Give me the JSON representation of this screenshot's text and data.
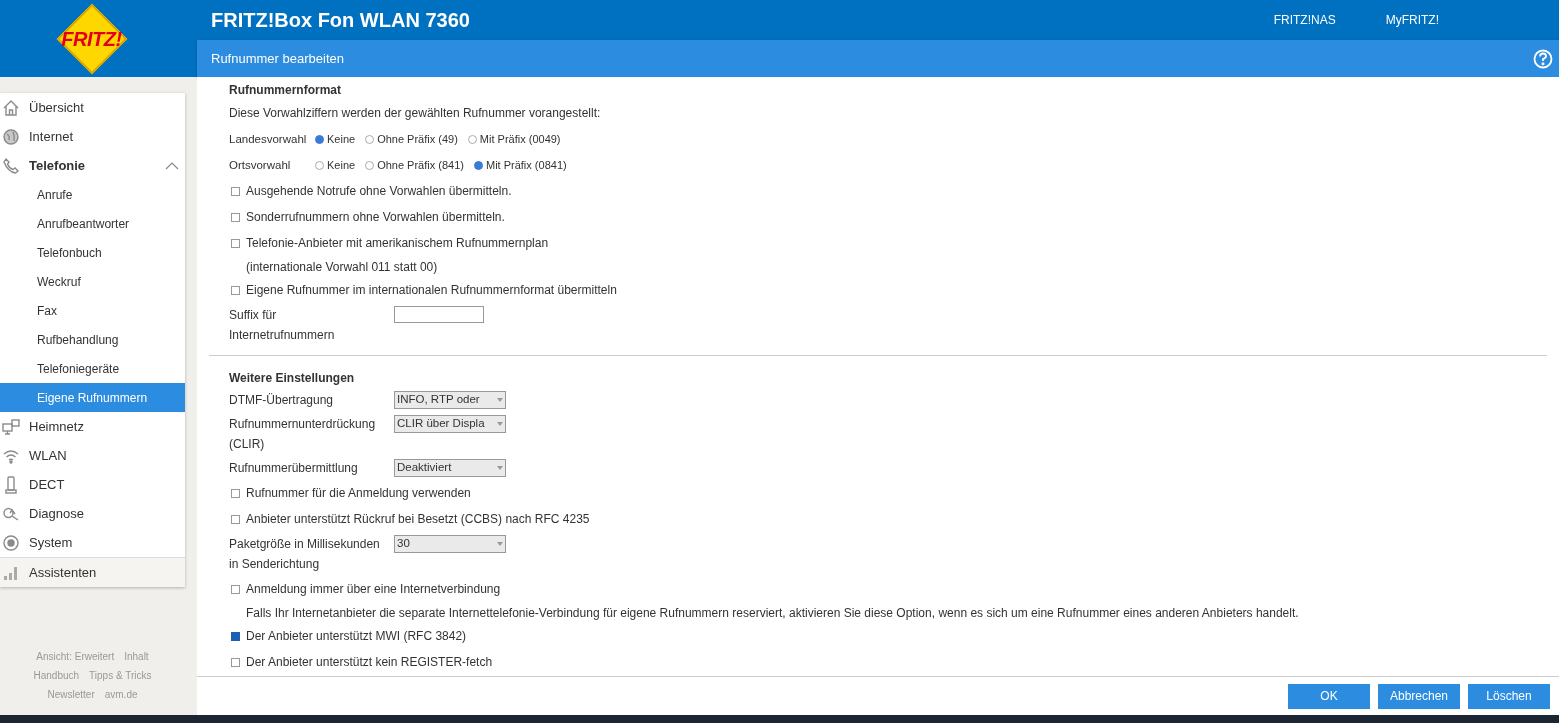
{
  "header": {
    "product_title": "FRITZ!Box Fon WLAN 7360",
    "links": [
      "FRITZ!NAS",
      "MyFRITZ!"
    ],
    "logo": "FRITZ!"
  },
  "page_title": "Rufnummer bearbeiten",
  "sidebar": {
    "items": [
      {
        "label": "Übersicht",
        "expanded": false,
        "selected": false
      },
      {
        "label": "Internet",
        "expanded": false,
        "selected": false
      },
      {
        "label": "Telefonie",
        "expanded": true,
        "selected": false,
        "children": [
          {
            "label": "Anrufe",
            "selected": false
          },
          {
            "label": "Anrufbeantworter",
            "selected": false
          },
          {
            "label": "Telefonbuch",
            "selected": false
          },
          {
            "label": "Weckruf",
            "selected": false
          },
          {
            "label": "Fax",
            "selected": false
          },
          {
            "label": "Rufbehandlung",
            "selected": false
          },
          {
            "label": "Telefoniegeräte",
            "selected": false
          },
          {
            "label": "Eigene Rufnummern",
            "selected": true
          }
        ]
      },
      {
        "label": "Heimnetz",
        "expanded": false,
        "selected": false
      },
      {
        "label": "WLAN",
        "expanded": false,
        "selected": false
      },
      {
        "label": "DECT",
        "expanded": false,
        "selected": false
      },
      {
        "label": "Diagnose",
        "expanded": false,
        "selected": false
      },
      {
        "label": "System",
        "expanded": false,
        "selected": false
      }
    ],
    "assistant": {
      "label": "Assistenten"
    },
    "footer_links": [
      [
        "Ansicht: Erweitert",
        "Inhalt"
      ],
      [
        "Handbuch",
        "Tipps & Tricks"
      ],
      [
        "Newsletter",
        "avm.de"
      ]
    ]
  },
  "sections": [
    {
      "title": "Rufnummernformat",
      "items": [
        {
          "kind": "text",
          "text": "Diese Vorwahlziffern werden der gewählten Rufnummer vorangestellt:"
        },
        {
          "kind": "radio",
          "label": "Landesvorwahl",
          "options": [
            {
              "label": "Keine",
              "selected": true
            },
            {
              "label": "Ohne Präfix (49)",
              "selected": false
            },
            {
              "label": "Mit Präfix (0049)",
              "selected": false
            }
          ]
        },
        {
          "kind": "radio",
          "label": "Ortsvorwahl",
          "options": [
            {
              "label": "Keine",
              "selected": false
            },
            {
              "label": "Ohne Präfix (841)",
              "selected": false
            },
            {
              "label": "Mit Präfix (0841)",
              "selected": true
            }
          ]
        },
        {
          "kind": "checkbox",
          "label": "Ausgehende Notrufe ohne Vorwahlen übermitteln.",
          "checked": false
        },
        {
          "kind": "checkbox",
          "label": "Sonderrufnummern ohne Vorwahlen übermitteln.",
          "checked": false
        },
        {
          "kind": "checkbox",
          "label": "Telefonie-Anbieter mit amerikanischem Rufnummernplan",
          "checked": false
        },
        {
          "kind": "note",
          "text": "(internationale Vorwahl 011 statt 00)"
        },
        {
          "kind": "checkbox",
          "label": "Eigene Rufnummer im internationalen Rufnummernformat übermitteln",
          "checked": false
        },
        {
          "kind": "input",
          "label": [
            "Suffix für",
            "Internetrufnummern"
          ]
        }
      ]
    },
    {
      "title": "Weitere Einstellungen",
      "items": [
        {
          "kind": "select",
          "label": [
            "DTMF-Übertragung"
          ],
          "value": "INFO, RTP oder"
        },
        {
          "kind": "select",
          "label": [
            "Rufnummernunterdrückung",
            "(CLIR)"
          ],
          "value": "CLIR über Displa"
        },
        {
          "kind": "select",
          "label": [
            "Rufnummerübermittlung"
          ],
          "value": "Deaktiviert"
        },
        {
          "kind": "checkbox",
          "label": "Rufnummer für die Anmeldung verwenden",
          "checked": false
        },
        {
          "kind": "checkbox",
          "label": "Anbieter unterstützt Rückruf bei Besetzt (CCBS) nach RFC 4235",
          "checked": false
        },
        {
          "kind": "select",
          "label": [
            "Paketgröße in Millisekunden",
            "in Senderichtung"
          ],
          "value": "30"
        },
        {
          "kind": "checkbox",
          "label": "Anmeldung immer über eine Internetverbindung",
          "checked": false
        },
        {
          "kind": "note",
          "text": "Falls Ihr Internetanbieter die separate Internettelefonie-Verbindung für eigene Rufnummern reserviert, aktivieren Sie diese Option, wenn es sich um eine Rufnummer eines anderen Anbieters handelt."
        },
        {
          "kind": "checkbox",
          "label": "Der Anbieter unterstützt MWI (RFC 3842)",
          "checked": true
        },
        {
          "kind": "checkbox",
          "label": "Der Anbieter unterstützt kein REGISTER-fetch",
          "checked": false
        }
      ]
    }
  ],
  "buttons": [
    "OK",
    "Abbrechen",
    "Löschen"
  ]
}
